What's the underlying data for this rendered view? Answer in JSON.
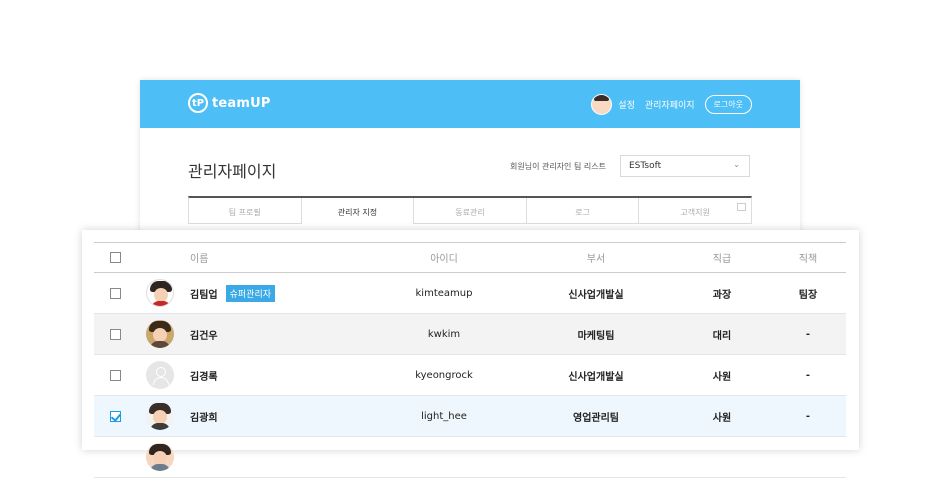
{
  "header": {
    "logo_mark": "tP",
    "logo_text": "teamUP",
    "settings_label": "설정",
    "admin_page_label": "관리자페이지",
    "logout_label": "로그아웃"
  },
  "page": {
    "title": "관리자페이지",
    "team_list_label": "회원님이 관리자인 팀 리스트",
    "team_select_value": "ESTsoft"
  },
  "tabs": [
    {
      "label": "팀 프로필"
    },
    {
      "label": "관리자 지정"
    },
    {
      "label": "동료관리"
    },
    {
      "label": "로그"
    },
    {
      "label": "고객지원"
    }
  ],
  "table": {
    "headers": {
      "name": "이름",
      "id": "아이디",
      "dept": "부서",
      "rank": "직급",
      "duty": "직책"
    },
    "rows": [
      {
        "name": "김팀업",
        "badge": "슈퍼관리자",
        "id": "kimteamup",
        "dept": "신사업개발실",
        "rank": "과장",
        "duty": "팀장",
        "checked": false
      },
      {
        "name": "김건우",
        "id": "kwkim",
        "dept": "마케팅팀",
        "rank": "대리",
        "duty": "-",
        "checked": false
      },
      {
        "name": "김경록",
        "id": "kyeongrock",
        "dept": "신사업개발실",
        "rank": "사원",
        "duty": "-",
        "checked": false
      },
      {
        "name": "김광희",
        "id": "light_hee",
        "dept": "영업관리팀",
        "rank": "사원",
        "duty": "-",
        "checked": true
      }
    ]
  },
  "colors": {
    "topbar": "#4dbef6",
    "accent": "#3aa9e6",
    "selected_row": "#eef7fd"
  }
}
